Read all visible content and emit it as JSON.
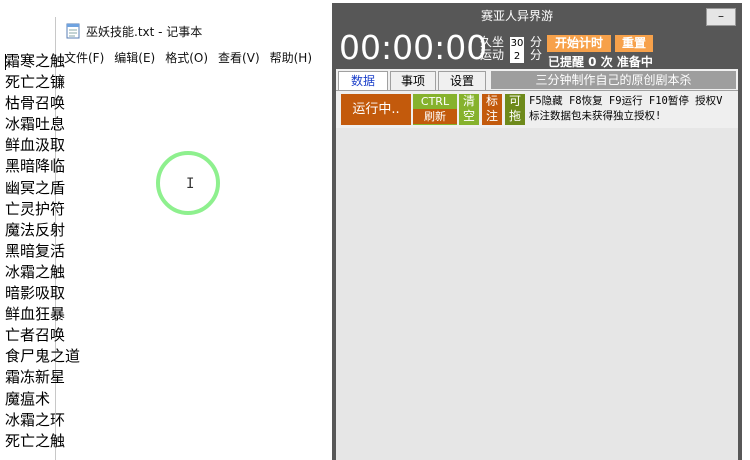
{
  "notepad": {
    "title": "巫妖技能.txt - 记事本",
    "menu": [
      "文件(F)",
      "编辑(E)",
      "格式(O)",
      "查看(V)",
      "帮助(H)"
    ],
    "lines": [
      "霜寒之触",
      "死亡之镰",
      "枯骨召唤",
      "冰霜吐息",
      "鲜血汲取",
      "黑暗降临",
      "幽冥之盾",
      "亡灵护符",
      "魔法反射",
      "黑暗复活",
      "冰霜之触",
      "暗影吸取",
      "鲜血狂暴",
      "亡者召唤",
      "食尸鬼之道",
      "霜冻新星",
      "魔瘟术",
      "冰霜之环",
      "死亡之触"
    ]
  },
  "timer": {
    "title": "赛亚人异界游",
    "minimize": "–",
    "clock": "00:00:00",
    "label_long": "久坐",
    "label_move": "运动",
    "val_long": "30",
    "val_move": "2",
    "unit_min": "分",
    "start_button": "开始计时",
    "reset_button": "重置",
    "reminded": "已提醒 0 次 准备中",
    "tabs": [
      "数据",
      "事项",
      "设置"
    ],
    "tab_desc": "三分钟制作自己的原创剧本杀",
    "run_status": "运行中..",
    "ctrl_top": "CTRL",
    "ctrl_bottom": "刷新",
    "btn_clear": "清空",
    "btn_mark": "标注",
    "btn_drag": "可拖",
    "info_line1": "F5隐藏 F8恢复 F9运行 F10暂停 授权V",
    "info_line2": "标注数据包未获得独立授权!"
  },
  "colors": {
    "timer_bg": "#575757",
    "accent_orange": "#f7a14a",
    "run_orange": "#c35a0c",
    "green": "#86b22d",
    "cursor_ring": "#8ef08e"
  }
}
